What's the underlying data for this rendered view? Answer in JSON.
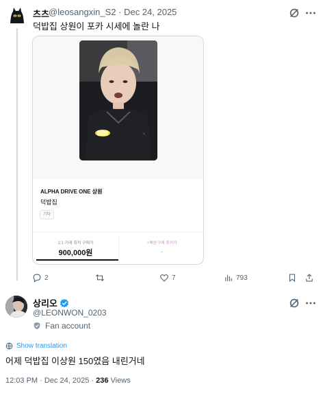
{
  "quoted_tweet": {
    "display_name": "츠츠",
    "handle": "@leosangxin_S2",
    "separator": "·",
    "date": "Dec 24, 2025",
    "text": "덕밥집 상원이 포카 시세에 놀란 나",
    "card": {
      "title": "ALPHA DRIVE ONE 상원",
      "name": "덕밥집",
      "tag": "기타",
      "left_label": "1:1 거래 최저 구매가",
      "price": "900,000원",
      "right_label": "⚡빠른구매 최저가",
      "right_value": "-"
    },
    "actions": {
      "replies": "2",
      "reposts": "",
      "likes": "7",
      "views": "793"
    },
    "icons": [
      "grok-icon",
      "more-icon",
      "reply-icon",
      "repost-icon",
      "like-icon",
      "views-icon",
      "bookmark-icon",
      "share-icon"
    ]
  },
  "main_tweet": {
    "display_name": "상리오",
    "verified": true,
    "handle": "@LEONWON_0203",
    "fan_label": "Fan account",
    "show_translation": "Show translation",
    "text": "어제 덕밥집 이상원 150였음 내린거네",
    "time": "12:03 PM",
    "date": "Dec 24, 2025",
    "views_count": "236",
    "views_label": "Views",
    "sep": "·"
  },
  "colors": {
    "accent": "#1d9bf0",
    "text": "#0f1419",
    "muted": "#536471",
    "border": "#cfd9de"
  }
}
